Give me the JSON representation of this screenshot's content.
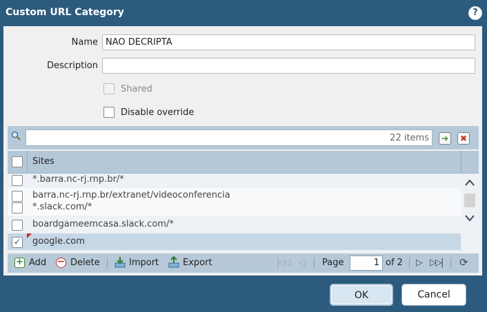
{
  "dialog": {
    "title": "Custom URL Category",
    "help_icon": "help-icon"
  },
  "form": {
    "name_label": "Name",
    "name_value": "NAO DECRIPTA",
    "description_label": "Description",
    "description_value": "",
    "shared_label": "Shared",
    "shared_checked": false,
    "disable_override_label": "Disable override",
    "disable_override_checked": false
  },
  "grid": {
    "items_count": "22 items",
    "column_header": "Sites",
    "rows": [
      {
        "site": "*.barra.nc-rj.rnp.br/*",
        "checked": false
      },
      {
        "site": "barra.nc-rj.rnp.br/extranet/videoconferencia",
        "checked": false
      },
      {
        "site": "*.slack.com/*",
        "checked": false
      },
      {
        "site": "boardgameemcasa.slack.com/*",
        "checked": false
      },
      {
        "site": "google.com",
        "checked": true
      }
    ]
  },
  "toolbar": {
    "add_label": "Add",
    "delete_label": "Delete",
    "import_label": "Import",
    "export_label": "Export",
    "page_label": "Page",
    "page_value": "1",
    "of_label": "of 2"
  },
  "buttons": {
    "ok_label": "OK",
    "cancel_label": "Cancel"
  },
  "colors": {
    "titlebar": "#2c5b7e",
    "header": "#b5c8d8",
    "selected_row": "#c6d7e6"
  }
}
